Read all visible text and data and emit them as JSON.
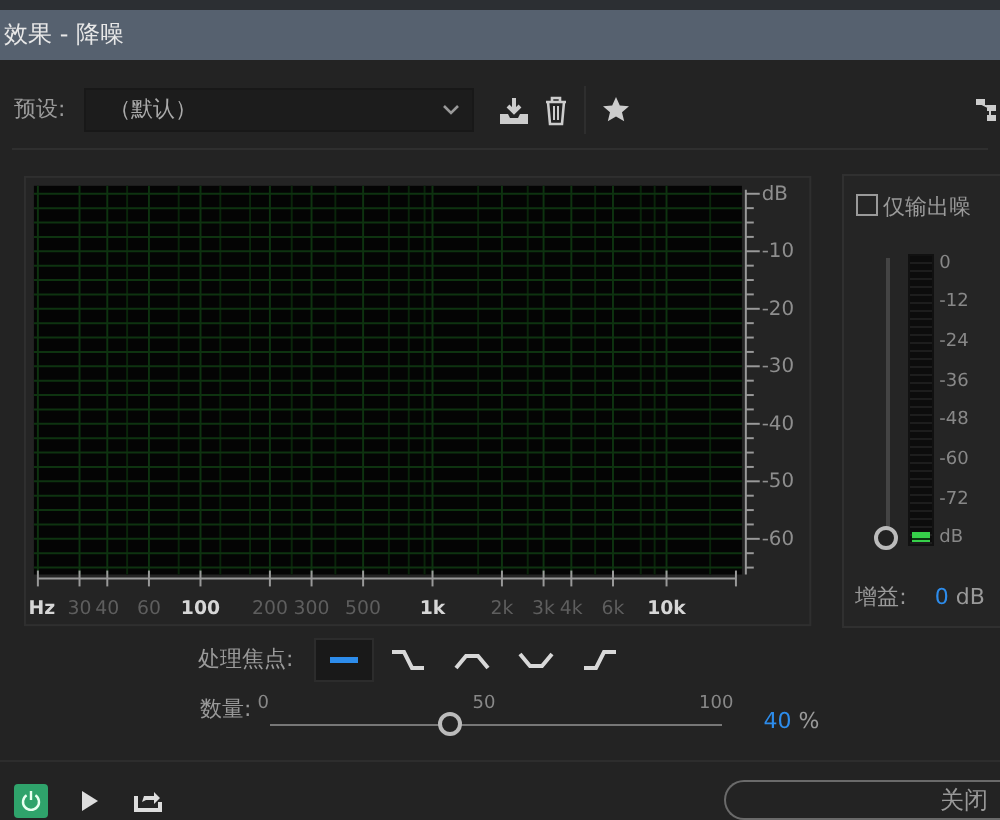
{
  "window": {
    "title": "效果 - 降噪"
  },
  "toolbar": {
    "preset_label": "预设:",
    "preset_value": "（默认）"
  },
  "graph": {
    "x_labels": [
      {
        "text": "Hz",
        "major": true
      },
      {
        "text": "30",
        "major": false
      },
      {
        "text": "40",
        "major": false
      },
      {
        "text": "60",
        "major": false
      },
      {
        "text": "100",
        "major": true
      },
      {
        "text": "200",
        "major": false
      },
      {
        "text": "300",
        "major": false
      },
      {
        "text": "500",
        "major": false
      },
      {
        "text": "1k",
        "major": true
      },
      {
        "text": "2k",
        "major": false
      },
      {
        "text": "3k",
        "major": false
      },
      {
        "text": "4k",
        "major": false
      },
      {
        "text": "6k",
        "major": false
      },
      {
        "text": "10k",
        "major": true
      }
    ],
    "y_labels": [
      "dB",
      "-10",
      "-20",
      "-30",
      "-40",
      "-50",
      "-60"
    ]
  },
  "side_panel": {
    "noise_only": {
      "label": "仅输出噪",
      "checked": false
    },
    "meter": {
      "level": 0.03,
      "labels": [
        "0",
        "-12",
        "-24",
        "-36",
        "-48",
        "-60",
        "-72",
        "dB"
      ]
    },
    "gain": {
      "label": "增益:",
      "level": 0,
      "value": "0",
      "unit": "dB"
    }
  },
  "focus": {
    "label": "处理焦点:",
    "options": [
      {
        "kind": "flat",
        "selected": true
      },
      {
        "kind": "falling",
        "selected": false
      },
      {
        "kind": "peak",
        "selected": false
      },
      {
        "kind": "dip",
        "selected": false
      },
      {
        "kind": "rising",
        "selected": false
      }
    ]
  },
  "amount": {
    "label": "数量:",
    "ticks": [
      "0",
      "50",
      "100"
    ],
    "level": 0.4,
    "reading": "40",
    "unit": "%"
  },
  "footer": {
    "power_on": true,
    "close_label": "关闭"
  }
}
